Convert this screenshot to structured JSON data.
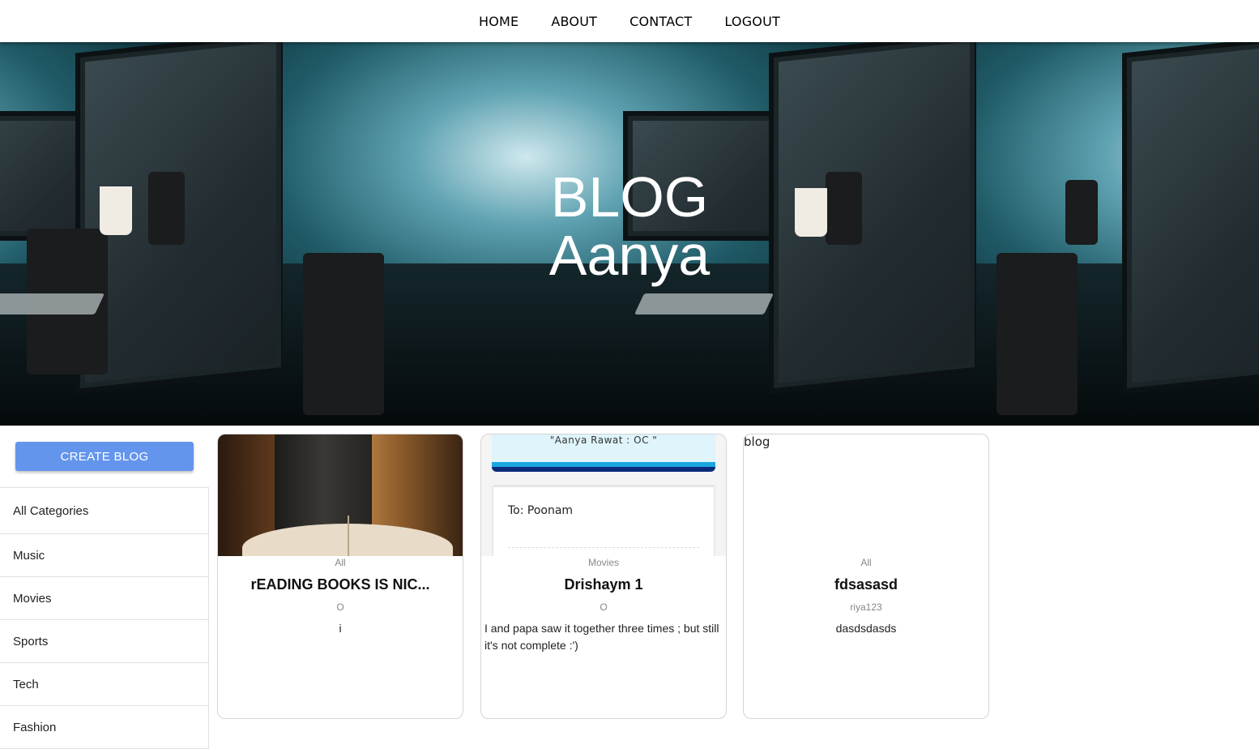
{
  "nav": {
    "items": [
      {
        "label": "HOME"
      },
      {
        "label": "ABOUT"
      },
      {
        "label": "CONTACT"
      },
      {
        "label": "LOGOUT"
      }
    ]
  },
  "hero": {
    "line1": "BLOG",
    "line2": "Aanya"
  },
  "sidebar": {
    "create_label": "CREATE BLOG",
    "categories": [
      {
        "label": "All Categories"
      },
      {
        "label": "Music"
      },
      {
        "label": "Movies"
      },
      {
        "label": "Sports"
      },
      {
        "label": "Tech"
      },
      {
        "label": "Fashion"
      }
    ]
  },
  "posts": [
    {
      "category": "All",
      "title": "rEADING BOOKS IS NIC...",
      "author": "O",
      "description": "i"
    },
    {
      "category": "Movies",
      "title": "Drishaym 1",
      "author": "O",
      "description": "I and papa saw it together three times ; but still it's not complete :')",
      "image_text": {
        "banner": "\"Aanya Rawat : OC \"",
        "to_line": "To: Poonam"
      }
    },
    {
      "category": "All",
      "title": "fdsasasd",
      "author": "riya123",
      "description": "dasdsdasds",
      "image_alt": "blog"
    }
  ]
}
